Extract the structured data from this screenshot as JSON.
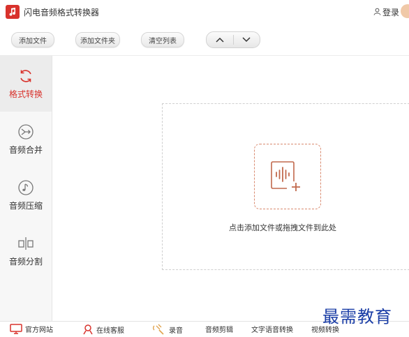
{
  "app": {
    "title": "闪电音频格式转换器",
    "login_label": "登录"
  },
  "toolbar": {
    "add_file": "添加文件",
    "add_folder": "添加文件夹",
    "clear_list": "清空列表",
    "move_up_icon": "chevron-up-icon",
    "move_down_icon": "chevron-down-icon"
  },
  "sidebar": {
    "items": [
      {
        "label": "格式转换",
        "icon": "refresh-icon",
        "active": true
      },
      {
        "label": "音频合并",
        "icon": "merge-icon",
        "active": false
      },
      {
        "label": "音频压缩",
        "icon": "music-note-icon",
        "active": false
      },
      {
        "label": "音频分割",
        "icon": "split-icon",
        "active": false
      }
    ]
  },
  "main": {
    "drop_hint": "点击添加文件或拖拽文件到此处",
    "drop_icon": "add-audio-icon"
  },
  "footer": {
    "items": [
      {
        "label": "官方网站",
        "icon": "monitor-icon"
      },
      {
        "label": "在线客服",
        "icon": "support-icon"
      },
      {
        "label": "录音",
        "icon": "record-icon"
      },
      {
        "label": "音频剪辑",
        "icon": ""
      },
      {
        "label": "文字语音转换",
        "icon": ""
      },
      {
        "label": "视频转换",
        "icon": ""
      }
    ]
  },
  "watermark": "最需教育",
  "colors": {
    "accent": "#d8322c",
    "drop_icon": "#d98a6f",
    "watermark": "#1a3da6"
  }
}
